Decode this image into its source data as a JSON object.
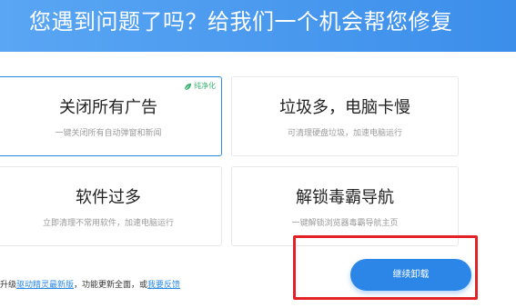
{
  "header": {
    "title": "您遇到问题了吗？给我们一个机会帮您修复"
  },
  "cards": [
    {
      "title": "关闭所有广告",
      "desc": "一键关闭所有自动弹窗和新闻",
      "badge": "纯净化",
      "selected": true
    },
    {
      "title": "垃圾多，电脑卡慢",
      "desc": "可清理硬盘垃圾，加速电脑运行",
      "selected": false
    },
    {
      "title": "软件过多",
      "desc": "立即清理不常用软件，加速电脑运行",
      "selected": false
    },
    {
      "title": "解锁毒霸导航",
      "desc": "一键解锁浏览器毒霸导航主页",
      "selected": false
    }
  ],
  "footer": {
    "prefix": "升级",
    "link1": "驱动精灵最新版",
    "middle": "，功能更新全面，或",
    "link2": "我要反馈"
  },
  "actions": {
    "continue_label": "继续卸载"
  },
  "colors": {
    "header_start": "#5aa6f4",
    "header_end": "#3b8eea",
    "accent": "#2b86e8",
    "badge_green": "#3cb371",
    "highlight_red": "#e32227"
  },
  "icons": {
    "badge_icon": "leaf-icon"
  }
}
